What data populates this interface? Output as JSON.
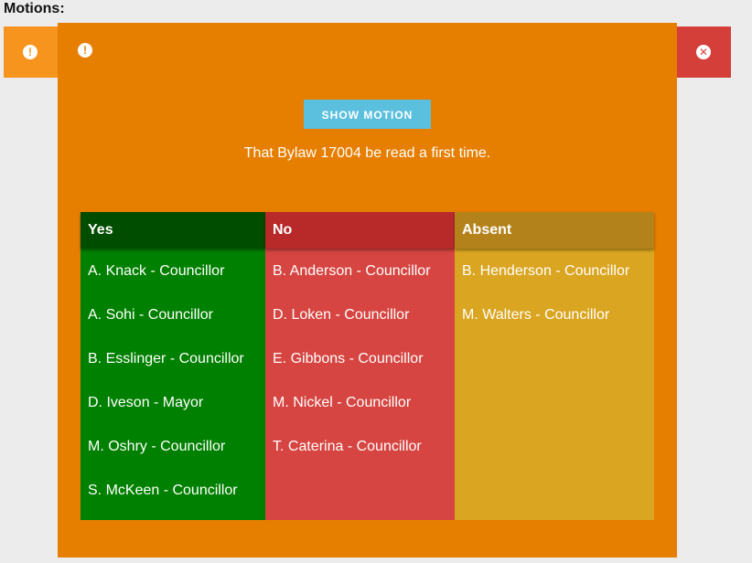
{
  "section": {
    "title": "Motions:"
  },
  "motion": {
    "show_button_label": "SHOW MOTION",
    "text": "That Bylaw 17004 be read a first time.",
    "status_icon": "exclamation-icon",
    "close_icon": "close-icon"
  },
  "votes": {
    "yes": {
      "header": "Yes",
      "members": [
        "A. Knack - Councillor",
        "A. Sohi - Councillor",
        "B. Esslinger - Councillor",
        "D. Iveson - Mayor",
        "M. Oshry - Councillor",
        "S. McKeen - Councillor"
      ]
    },
    "no": {
      "header": "No",
      "members": [
        "B. Anderson - Councillor",
        "D. Loken - Councillor",
        "E. Gibbons - Councillor",
        "M. Nickel - Councillor",
        "T. Caterina - Councillor"
      ]
    },
    "absent": {
      "header": "Absent",
      "members": [
        "B. Henderson - Councillor",
        "M. Walters - Councillor"
      ]
    }
  },
  "colors": {
    "card": "#e67e00",
    "bar_left": "#f7941d",
    "bar_right": "#d43f3a",
    "button": "#5bc0de",
    "yes": "#008000",
    "yes_header": "#004d00",
    "no": "#d64541",
    "no_header": "#b8292a",
    "absent": "#daa520",
    "absent_header": "#b3821a"
  }
}
